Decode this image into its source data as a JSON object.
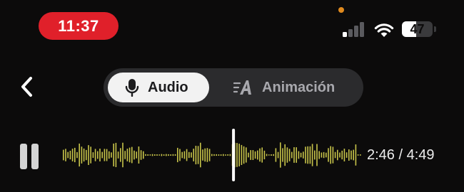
{
  "status_bar": {
    "time": "11:37",
    "battery_level": "47",
    "battery_fraction": 0.47,
    "signal_bars_active": 1,
    "signal_bars_total": 4
  },
  "nav": {
    "back_icon": "chevron-left-icon",
    "tabs": [
      {
        "label": "Audio",
        "icon": "microphone-icon",
        "selected": true
      },
      {
        "label": "Animación",
        "icon": "text-animation-icon",
        "selected": false
      }
    ]
  },
  "player": {
    "state_icon": "pause-icon",
    "current_time": "2:46",
    "separator": "/",
    "total_time": "4:49",
    "progress_fraction": 0.574,
    "colors": {
      "wave": "#c8c44a",
      "playhead": "#ffffff"
    }
  },
  "colors": {
    "time_pill": "#e0202a",
    "background": "#0c0b0b",
    "privacy_dot": "#e08a1e"
  }
}
